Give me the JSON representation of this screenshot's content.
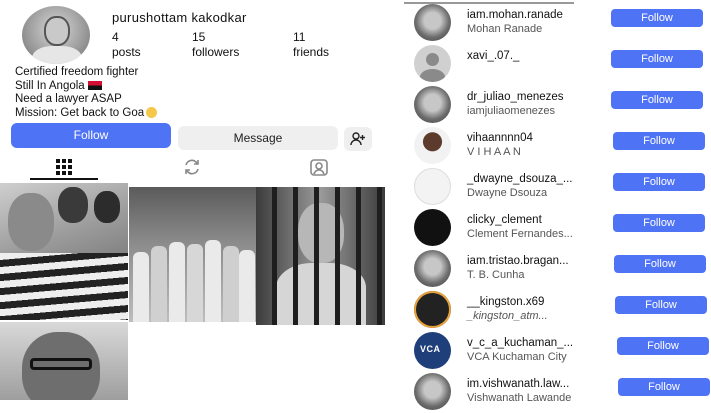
{
  "profile": {
    "username": "purushottam kakodkar",
    "stats": [
      {
        "value": "4",
        "label": "posts"
      },
      {
        "value": "15",
        "label": "followers"
      },
      {
        "value": "11",
        "label": "friends"
      }
    ],
    "bio": [
      "Certified freedom fighter",
      "Still In Angola",
      "Need a lawyer ASAP",
      "Mission: Get back to Goa"
    ],
    "buttons": {
      "follow": "Follow",
      "message": "Message"
    },
    "tabs": [
      "grid-icon",
      "reels-icon",
      "tagged-icon"
    ],
    "accent": "#4f73f5"
  },
  "followers": [
    {
      "username": "iam.mohan.ranade",
      "name": "Mohan Ranade",
      "button": "Follow"
    },
    {
      "username": "xavi_.07._",
      "name": "",
      "button": "Follow"
    },
    {
      "username": "dr_juliao_menezes",
      "name": "iamjuliaomenezes",
      "button": "Follow"
    },
    {
      "username": "vihaannnn04",
      "name": "V I H A A N",
      "button": "Follow"
    },
    {
      "username": "_dwayne_dsouza_...",
      "name": "Dwayne Dsouza",
      "button": "Follow"
    },
    {
      "username": "clicky_clement",
      "name": "Clement Fernandes...",
      "button": "Follow"
    },
    {
      "username": "iam.tristao.bragan...",
      "name": "T. B. Cunha",
      "button": "Follow"
    },
    {
      "username": "__kingston.x69",
      "name": "_kingston_atm...",
      "button": "Follow"
    },
    {
      "username": "v_c_a_kuchaman_...",
      "name": "VCA Kuchaman City",
      "button": "Follow"
    },
    {
      "username": "im.vishwanath.law...",
      "name": "Vishwanath Lawande",
      "button": "Follow"
    }
  ]
}
